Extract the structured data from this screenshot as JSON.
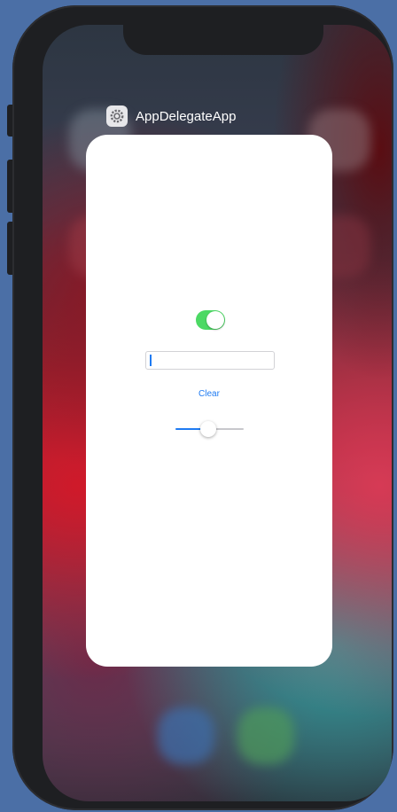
{
  "app_switcher": {
    "app_title": "AppDelegateApp",
    "app_icon": "settings-gear-icon"
  },
  "controls": {
    "toggle_on": true,
    "text_field_value": "",
    "clear_label": "Clear",
    "slider_value": 0.5
  },
  "colors": {
    "accent": "#1f7bf2",
    "switch_on": "#4cd964",
    "bezel": "#1e1f22"
  }
}
